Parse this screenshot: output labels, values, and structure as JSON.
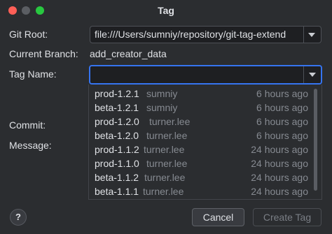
{
  "window": {
    "title": "Tag"
  },
  "form": {
    "git_root_label": "Git Root:",
    "git_root_value": "file:///Users/sumniy/repository/git-tag-extend",
    "current_branch_label": "Current Branch:",
    "current_branch_value": "add_creator_data",
    "tag_name_label": "Tag Name:",
    "tag_name_value": "",
    "commit_label": "Commit:",
    "message_label": "Message:"
  },
  "tag_list": [
    {
      "tag": "prod-1.2.1",
      "author": "sumniy",
      "time": "6 hours ago"
    },
    {
      "tag": "beta-1.2.1",
      "author": "sumniy",
      "time": "6 hours ago"
    },
    {
      "tag": "prod-1.2.0",
      "author": "turner.lee",
      "time": "6 hours ago"
    },
    {
      "tag": "beta-1.2.0",
      "author": "turner.lee",
      "time": "6 hours ago"
    },
    {
      "tag": "prod-1.1.2",
      "author": "turner.lee",
      "time": "24 hours ago"
    },
    {
      "tag": "prod-1.1.0",
      "author": "turner.lee",
      "time": "24 hours ago"
    },
    {
      "tag": "beta-1.1.2",
      "author": "turner.lee",
      "time": "24 hours ago"
    },
    {
      "tag": "beta-1.1.1",
      "author": "turner.lee",
      "time": "24 hours ago"
    }
  ],
  "footer": {
    "help_label": "?",
    "cancel_label": "Cancel",
    "create_tag_label": "Create Tag"
  },
  "icons": {
    "window_close": "close-icon",
    "window_minimize": "minimize-icon",
    "window_zoom": "zoom-icon",
    "combo_arrow": "chevron-down-icon",
    "help": "help-icon"
  },
  "colors": {
    "background": "#2b2d30",
    "field_background": "#1e1f22",
    "focus_border": "#3574f0",
    "close": "#ff5f57",
    "zoom": "#28c840"
  }
}
